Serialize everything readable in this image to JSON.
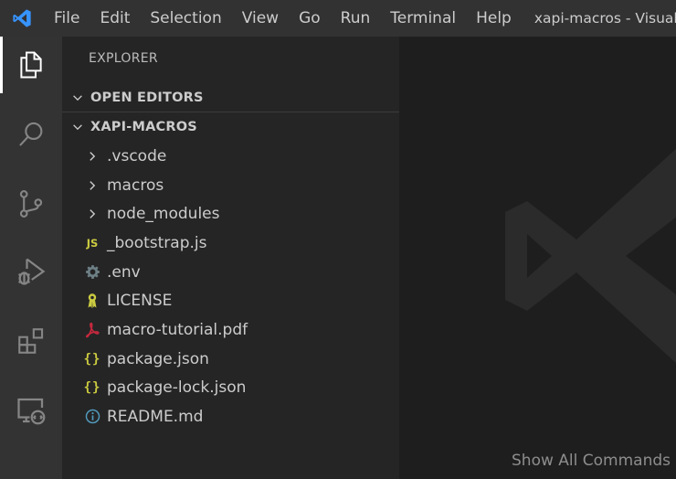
{
  "titlebar": {
    "menu": [
      "File",
      "Edit",
      "Selection",
      "View",
      "Go",
      "Run",
      "Terminal",
      "Help"
    ],
    "window_title": "xapi-macros - Visual Studio Code"
  },
  "activity_bar": {
    "items": [
      {
        "name": "explorer",
        "icon": "files-icon",
        "active": true
      },
      {
        "name": "search",
        "icon": "search-icon"
      },
      {
        "name": "source-control",
        "icon": "source-control-icon"
      },
      {
        "name": "run-debug",
        "icon": "run-debug-icon"
      },
      {
        "name": "extensions",
        "icon": "extensions-icon"
      },
      {
        "name": "remote-explorer",
        "icon": "remote-explorer-icon"
      }
    ]
  },
  "sidebar": {
    "title": "EXPLORER",
    "open_editors": "OPEN EDITORS",
    "project": "XAPI-MACROS",
    "items": [
      {
        "label": ".vscode",
        "icon": "chevron-right-icon"
      },
      {
        "label": "macros",
        "icon": "chevron-right-icon"
      },
      {
        "label": "node_modules",
        "icon": "chevron-right-icon"
      },
      {
        "label": "_bootstrap.js",
        "icon": "js-file-icon",
        "badge": "JS"
      },
      {
        "label": ".env",
        "icon": "gear-icon"
      },
      {
        "label": "LICENSE",
        "icon": "license-icon"
      },
      {
        "label": "macro-tutorial.pdf",
        "icon": "pdf-icon"
      },
      {
        "label": "package.json",
        "icon": "json-icon",
        "badge": "{}"
      },
      {
        "label": "package-lock.json",
        "icon": "json-icon",
        "badge": "{}"
      },
      {
        "label": "README.md",
        "icon": "info-icon"
      }
    ]
  },
  "editor": {
    "hint": "Show All Commands"
  },
  "colors": {
    "accent_blue": "#3794ff",
    "js_yellow": "#cbcb41",
    "pdf_red": "#c5283d"
  }
}
